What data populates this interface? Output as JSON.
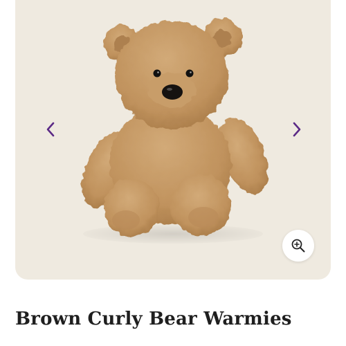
{
  "gallery": {
    "image_subject": "teddy-bear-plush",
    "prev_icon": "chevron-left-icon",
    "next_icon": "chevron-right-icon",
    "zoom_icon": "zoom-in-icon",
    "accent_color": "#5b2a86",
    "background_color": "#efeae0"
  },
  "product": {
    "title": "Brown Curly Bear Warmies"
  }
}
